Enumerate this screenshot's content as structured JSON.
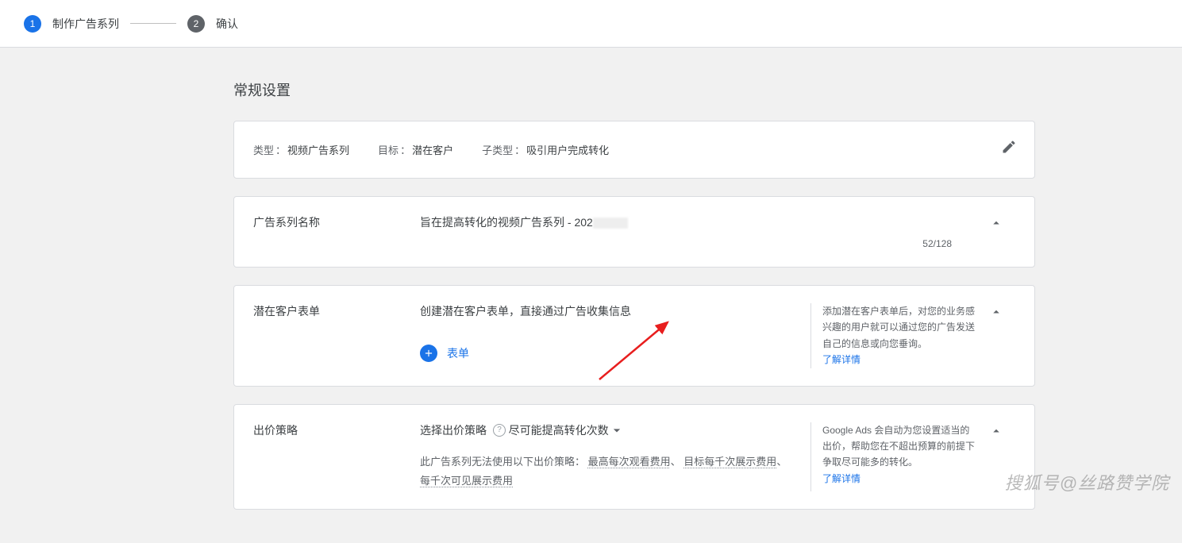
{
  "stepper": {
    "step1_num": "1",
    "step1_label": "制作广告系列",
    "step2_num": "2",
    "step2_label": "确认"
  },
  "section_title": "常规设置",
  "type_card": {
    "type_label": "类型",
    "type_val": "视频广告系列",
    "goal_label": "目标",
    "goal_val": "潜在客户",
    "subtype_label": "子类型",
    "subtype_val": "吸引用户完成转化"
  },
  "name_card": {
    "label": "广告系列名称",
    "value": "旨在提高转化的视频广告系列 - 202",
    "count": "52/128"
  },
  "lead_card": {
    "label": "潜在客户表单",
    "desc": "创建潜在客户表单，直接通过广告收集信息",
    "add_label": "表单",
    "side": "添加潜在客户表单后，对您的业务感兴趣的用户就可以通过您的广告发送自己的信息或向您垂询。",
    "learn": "了解详情"
  },
  "bid_card": {
    "label": "出价策略",
    "select_label": "选择出价策略",
    "dropdown": "尽可能提高转化次数",
    "note_prefix": "此广告系列无法使用以下出价策略：",
    "opt1": "最高每次观看费用",
    "sep1": "、",
    "opt2": "目标每千次展示费用",
    "sep2": "、",
    "opt3": "每千次可见展示费用",
    "side": "Google Ads 会自动为您设置适当的出价，帮助您在不超出预算的前提下争取尽可能多的转化。",
    "learn": "了解详情"
  },
  "watermark": "搜狐号@丝路赞学院"
}
